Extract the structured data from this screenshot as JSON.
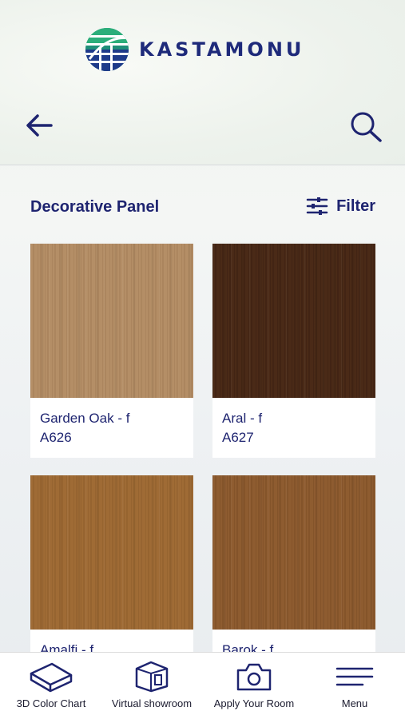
{
  "brand": {
    "name": "KASTAMONU"
  },
  "header": {
    "back": "back-arrow-icon",
    "search": "search-icon"
  },
  "section": {
    "title": "Decorative Panel",
    "filter_label": "Filter"
  },
  "products": [
    {
      "name": "Garden Oak - f",
      "code": "A626",
      "color": "#b48e66",
      "grain": "#a27c55"
    },
    {
      "name": "Aral - f",
      "code": "A627",
      "color": "#4a2a17",
      "grain": "#3a1f10"
    },
    {
      "name": "Amalfi - f",
      "code": "",
      "color": "#9f6b35",
      "grain": "#8c5c2a"
    },
    {
      "name": "Barok - f",
      "code": "",
      "color": "#8e5c30",
      "grain": "#7b4d25"
    }
  ],
  "tabs": [
    {
      "label": "3D Color Chart",
      "icon": "panel-3d-icon"
    },
    {
      "label": "Virtual showroom",
      "icon": "cube-room-icon"
    },
    {
      "label": "Apply Your Room",
      "icon": "camera-icon"
    },
    {
      "label": "Menu",
      "icon": "menu-icon"
    }
  ],
  "colors": {
    "brand_navy": "#1e2470",
    "logo_green": "#2f9a6a",
    "logo_blue": "#1e2a7a"
  }
}
